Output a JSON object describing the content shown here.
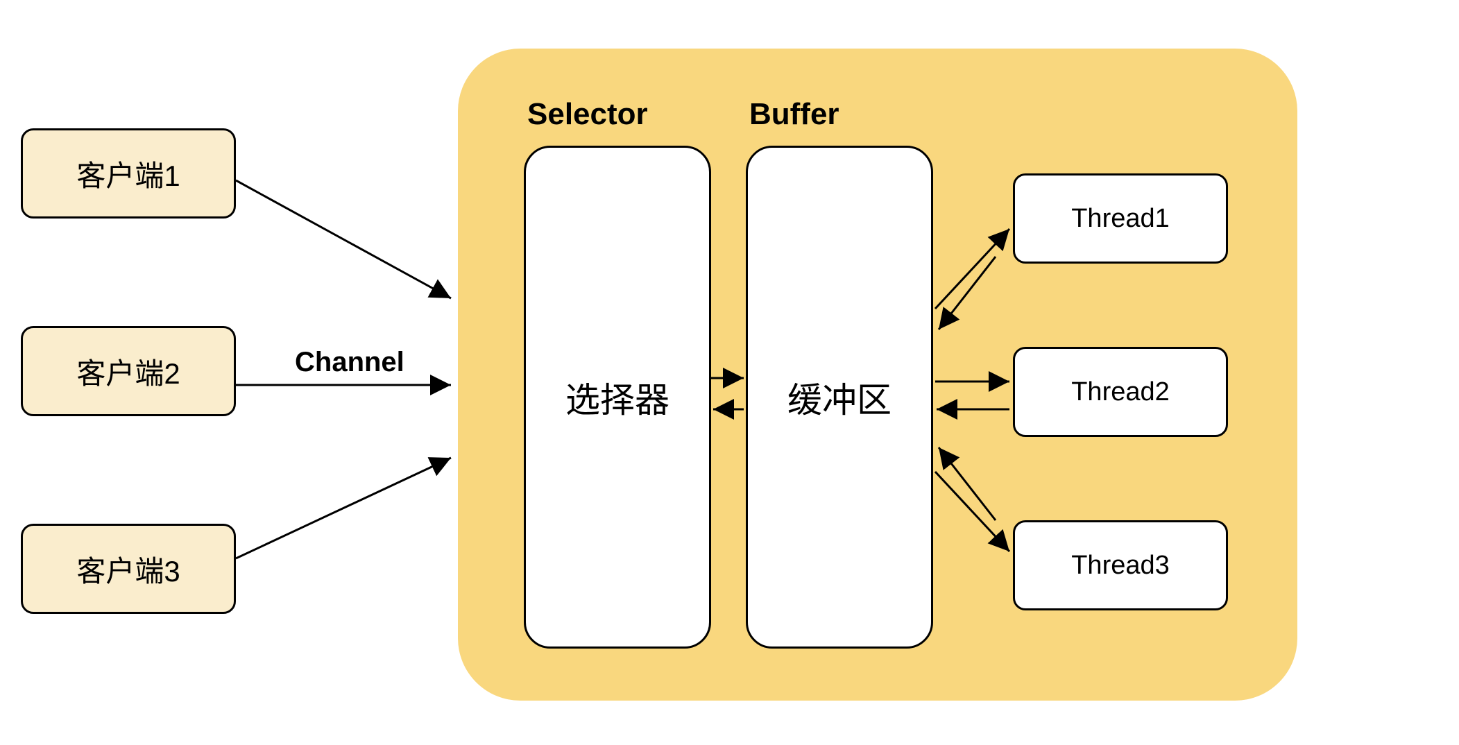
{
  "clients": [
    {
      "label": "客户端1"
    },
    {
      "label": "客户端2"
    },
    {
      "label": "客户端3"
    }
  ],
  "server": {
    "selector_header": "Selector",
    "buffer_header": "Buffer",
    "selector_label": "选择器",
    "buffer_label": "缓冲区",
    "threads": [
      {
        "label": "Thread1"
      },
      {
        "label": "Thread2"
      },
      {
        "label": "Thread3"
      }
    ]
  },
  "channel_label": "Channel"
}
